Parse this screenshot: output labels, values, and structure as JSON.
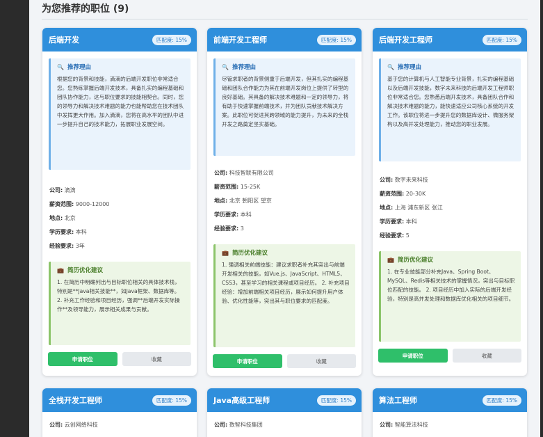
{
  "page": {
    "title": "为您推荐的职位 (9)"
  },
  "labels": {
    "reason_title": "推荐理由",
    "advice_title": "简历优化建议",
    "company": "公司:",
    "salary": "薪资范围:",
    "location": "地点:",
    "education": "学历要求:",
    "experience": "经验要求:",
    "apply": "申请职位",
    "favorite": "收藏"
  },
  "icons": {
    "reason": "magnifier-icon",
    "advice": "briefcase-icon"
  },
  "colors": {
    "header": "#2f8fdc",
    "apply": "#2fbf6a",
    "reason_bg": "#eaf3fc",
    "advice_bg": "#edf6e6"
  },
  "cards": [
    {
      "title": "后端开发",
      "match": "匹配度: 15%",
      "reason": "根据您的背景和技能，滴滴的后端开发职位非常适合您。您熟练掌握后端开发技术，具备扎实的编程基础和团队协作能力，这与职位要求的技能相契合。同时，您的领导力和解决技术难题的能力也能帮助您在技术团队中发挥更大作用。加入滴滴，您将在高水平的团队中进一步提升自己的技术能力，拓展职业发展空间。",
      "company": "滴滴",
      "salary": "9000-12000",
      "location": "北京",
      "education": "本科",
      "experience": "3年",
      "advice": "1. 在简历中明确列出与目标职位相关的具体技术栈，特别是**Java相关技能**，如Java框架、数据库等。 2. 补充工作经验和项目经历，强调**后端开发实际操作**及领导能力，展示相关成果与贡献。"
    },
    {
      "title": "前端开发工程师",
      "match": "匹配度: 15%",
      "reason": "尽管求职者的背景侧重于后端开发，但其扎实的编程基础和团队合作能力为其在前端开发岗位上提供了转型的良好基础。其具备的解决技术难题和一定的领导力，将有助于快速掌握前端技术，并为团队贡献技术解决方案。此职位可促进其跨领域的能力提升，为未来的全栈开发之路奠定坚实基础。",
      "company": "科技智联有限公司",
      "salary": "15-25K",
      "location": "北京 朝阳区 望京",
      "education": "本科",
      "experience": "3",
      "advice": "1. 强调相关前端技能：建议求职者补充其突出与前端开发相关的技能，如Vue.js、JavaScript、HTML5、CSS3，甚至学习的相关课程或项目经历。 2. 补充项目经验：增加前端相关项目经历，展示如何提升用户体验、优化性能等，突出其与职位要求的匹配度。"
    },
    {
      "title": "后端开发工程师",
      "match": "匹配度: 15%",
      "reason": "基于您的计算机与人工智能专业背景，扎实的编程基础以及后端开发技能，数字未来科技的后端开发工程师职位非常适合您。您熟悉后端开发技术，具备团队合作和解决技术难题的能力，能快速适应公司核心系统的开发工作。该职位将进一步提升您的数据库设计、微服务架构以及高并发处理能力，推动您的职业发展。",
      "company": "数字未来科技",
      "salary": "20-30K",
      "location": "上海 浦东新区 张江",
      "education": "本科",
      "experience": "5",
      "advice": "1. 在专业技能部分补充Java、Spring Boot、MySQL、Redis等相关技术的掌握情况，突出与目标职位匹配的技能。 2. 项目经历中加入实际的后端开发经验，特别是高并发处理和数据库优化相关的项目细节。"
    },
    {
      "title": "全栈开发工程师",
      "match": "匹配度: 15%",
      "company": "云创网络科技"
    },
    {
      "title": "Java高级工程师",
      "match": "匹配度: 15%",
      "company": "数智科技集团"
    },
    {
      "title": "算法工程师",
      "match": "匹配度: 15%",
      "company": "智能算法科技"
    }
  ]
}
